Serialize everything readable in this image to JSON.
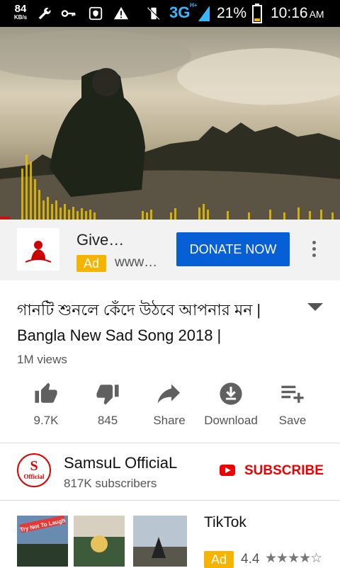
{
  "status_bar": {
    "net_speed": "84",
    "net_unit": "KB/s",
    "network": "3G",
    "network_sup": "H+",
    "battery_pct": "21%",
    "time": "10:16",
    "ampm": "AM"
  },
  "ad": {
    "title": "Give…",
    "badge": "Ad",
    "url": "www…",
    "cta": "DONATE NOW"
  },
  "video": {
    "title_line1": "গানটি শুনলে কেঁদে উঠবে আপনার মন |",
    "title_line2": "Bangla New Sad Song 2018 |",
    "views": "1M views"
  },
  "actions": [
    {
      "label": "9.7K",
      "icon": "thumbs-up-icon"
    },
    {
      "label": "845",
      "icon": "thumbs-down-icon"
    },
    {
      "label": "Share",
      "icon": "share-icon"
    },
    {
      "label": "Download",
      "icon": "download-icon"
    },
    {
      "label": "Save",
      "icon": "playlist-add-icon"
    }
  ],
  "channel": {
    "name": "SamsuL OfficiaL",
    "subscribers": "817K subscribers",
    "avatar_letter": "S",
    "avatar_text": "Official",
    "subscribe_label": "SUBSCRIBE"
  },
  "bottom_ad": {
    "title": "TikTok",
    "badge": "Ad",
    "rating": "4.4",
    "stars": "★★★★☆",
    "thumb_caption": "Try Not To Laugh"
  },
  "colors": {
    "accent_blue": "#065fd4",
    "youtube_red": "#e00000",
    "ad_yellow": "#f4b400"
  }
}
